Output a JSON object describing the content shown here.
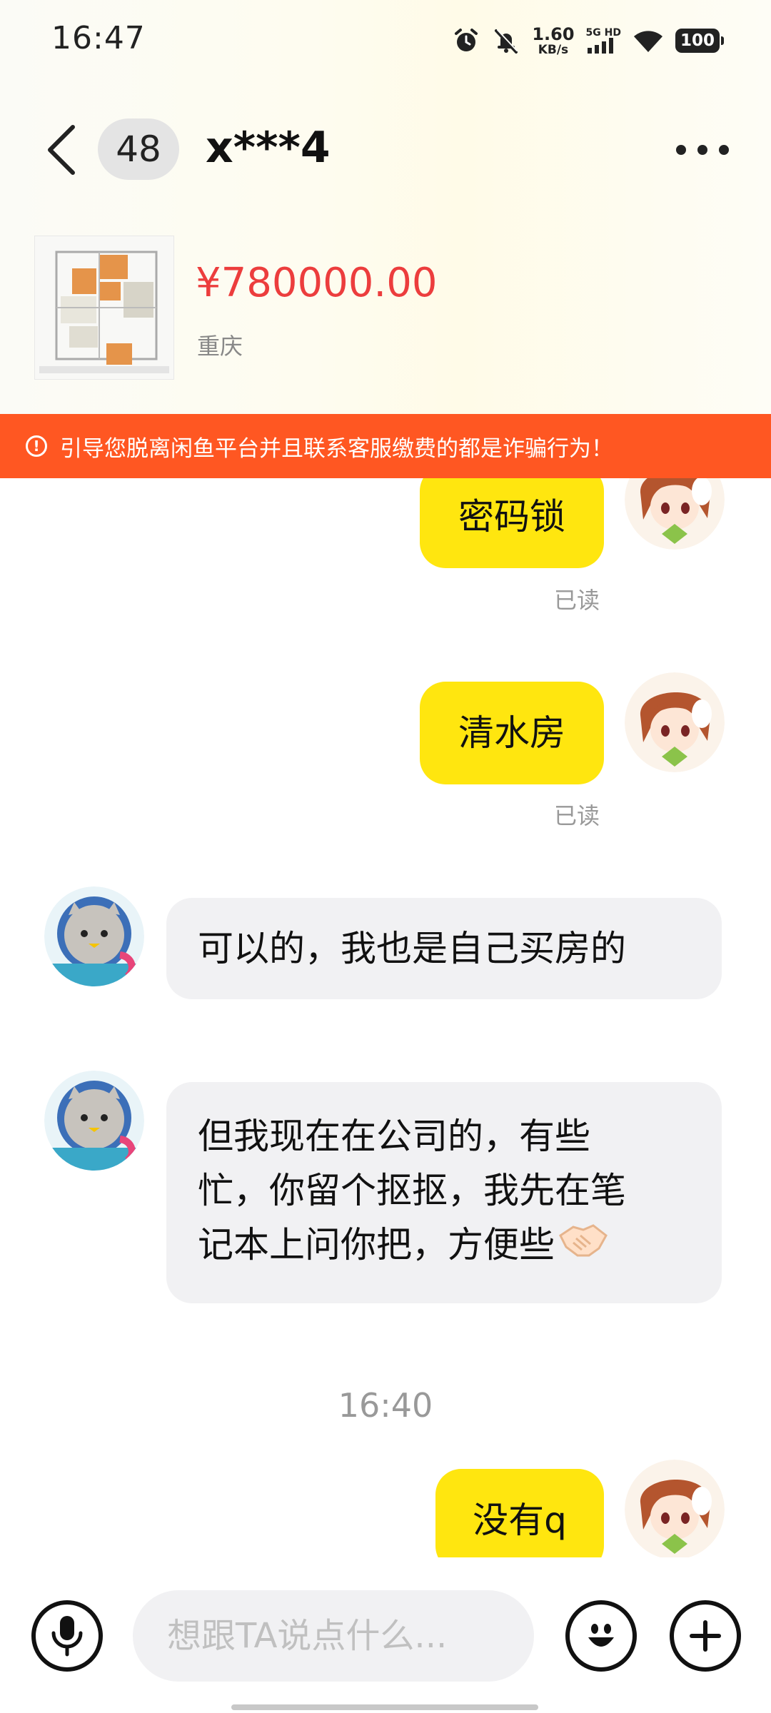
{
  "status_bar": {
    "time": "16:47",
    "net_speed_value": "1.60",
    "net_speed_unit": "KB/s",
    "signal_label": "5G HD",
    "battery": "100"
  },
  "nav": {
    "unread_count": "48",
    "title": "x***4"
  },
  "product": {
    "price": "¥780000.00",
    "location": "重庆"
  },
  "warning": {
    "text": "引导您脱离闲鱼平台并且联系客服缴费的都是诈骗行为！"
  },
  "messages": [
    {
      "direction": "out",
      "text": "密码锁",
      "status": "已读"
    },
    {
      "direction": "out",
      "text": "清水房",
      "status": "已读"
    },
    {
      "direction": "in",
      "text": "可以的，我也是自己买房的"
    },
    {
      "direction": "in",
      "lines": [
        "但我现在在公司的，有些",
        "忙，你留个抠抠，我先在笔",
        "记本上问你把，方便些"
      ]
    },
    {
      "direction": "out",
      "text": "没有q"
    }
  ],
  "timestamp": "16:40",
  "input": {
    "placeholder": "想跟TA说点什么..."
  },
  "colors": {
    "accent_yellow": "#ffe60f",
    "warning_orange": "#ff5722",
    "price_red": "#ec3d3d"
  }
}
